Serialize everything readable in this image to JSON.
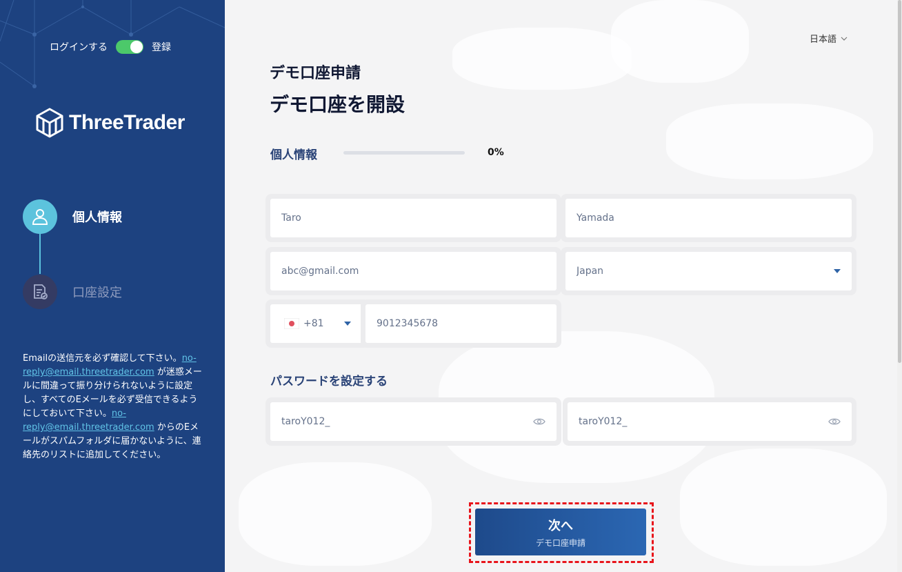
{
  "sidebar": {
    "auth_toggle": {
      "login_label": "ログインする",
      "register_label": "登録"
    },
    "logo_text": "ThreeTrader",
    "steps": [
      {
        "label": "個人情報",
        "state": "active"
      },
      {
        "label": "口座設定",
        "state": "inactive"
      }
    ],
    "notice": {
      "part1": "Emailの送信元を必ず確認して下さい。",
      "email1": "no-reply@email.threetrader.com",
      "part2": " が迷惑メールに間違って振り分けられないように設定し、すべてのEメールを必ず受信できるようにしておいて下さい。",
      "email2": "no-reply@email.threetrader.com",
      "part3": " からのEメールがスパムフォルダに届かないように、連絡先のリストに追加してください。"
    }
  },
  "header": {
    "language": "日本語",
    "subtitle": "デモ口座申請",
    "title": "デモ口座を開設"
  },
  "personal_section": {
    "label": "個人情報",
    "progress_value": 0,
    "progress_text": "0%"
  },
  "form": {
    "first_name": "Taro",
    "last_name": "Yamada",
    "email": "abc@gmail.com",
    "country": "Japan",
    "phone_code": "+81",
    "phone_number": "9012345678"
  },
  "password_section": {
    "label": "パスワードを設定する",
    "password": "taroY012_",
    "confirm_password": "taroY012_"
  },
  "next_button": {
    "label": "次へ",
    "sub_label": "デモ口座申請"
  },
  "colors": {
    "sidebar_bg": "#1d4280",
    "accent_cyan": "#5cc3dd",
    "toggle_green": "#4cc96a",
    "button_blue": "#2b67b3",
    "highlight_red": "#e8141b"
  }
}
